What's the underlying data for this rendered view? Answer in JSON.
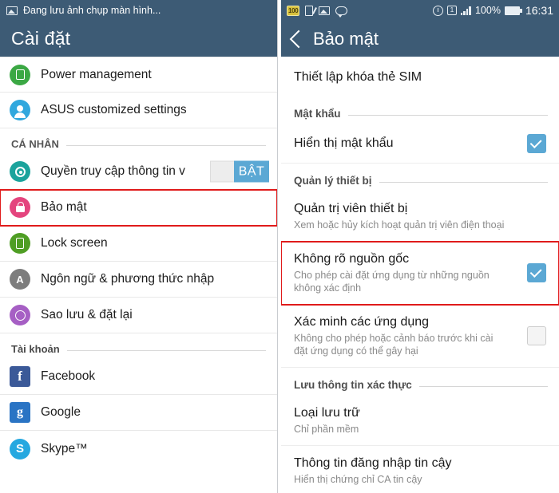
{
  "colors": {
    "header_bg": "#3d5b75",
    "accent_checkbox": "#5ba8d4",
    "highlight_outline": "#e01b1b",
    "toggle_on": "#5ba8d4"
  },
  "left_screen": {
    "statusbar": {
      "screenshot_icon": "screenshot-icon",
      "text": "Đang lưu ảnh chụp màn hình..."
    },
    "title": "Cài đặt",
    "items_top": [
      {
        "label": "Power management",
        "icon": "battery-clip-icon",
        "icon_color": "#3ba844"
      },
      {
        "label": "ASUS customized settings",
        "icon": "user-gear-icon",
        "icon_color": "#31a8de"
      }
    ],
    "section_personal": "CÁ NHÂN",
    "location_row": {
      "label": "Quyền truy cập thông tin v",
      "icon": "location-target-icon",
      "icon_color": "#1ba39c",
      "toggle_label": "BẬT"
    },
    "items_personal": [
      {
        "label": "Bảo mật",
        "icon": "lock-icon",
        "icon_color": "#e4457e",
        "highlighted": true
      },
      {
        "label": "Lock screen",
        "icon": "phone-lock-icon",
        "icon_color": "#4f9e24",
        "highlighted": false
      },
      {
        "label": "Ngôn ngữ & phương thức nhập",
        "icon": "letter-a-icon",
        "icon_color": "#7d7d7d",
        "highlighted": false
      },
      {
        "label": "Sao lưu & đặt lại",
        "icon": "backup-restore-icon",
        "icon_color": "#a65fc4",
        "highlighted": false
      }
    ],
    "section_accounts": "Tài khoản",
    "items_accounts": [
      {
        "label": "Facebook",
        "icon": "facebook-icon",
        "icon_color": "#3b5998",
        "glyph": "f"
      },
      {
        "label": "Google",
        "icon": "google-icon",
        "icon_color": "#2a74c4",
        "glyph": "g"
      },
      {
        "label": "Skype™",
        "icon": "skype-icon",
        "icon_color": "#26a8e0",
        "glyph": "S"
      }
    ]
  },
  "right_screen": {
    "statusbar": {
      "battery_badge": "100",
      "note_icon": "note-pencil-icon",
      "screenshot_icon": "screenshot-icon",
      "chat_icon": "chat-bubble-icon",
      "alarm_icon": "alarm-clock-icon",
      "sim_label": "1",
      "signal_icon": "signal-bars-icon",
      "battery_percent": "100%",
      "battery_icon": "battery-full-icon",
      "clock": "16:31"
    },
    "back_icon": "back-chevron-icon",
    "title": "Bảo mật",
    "sim_lock_item": {
      "title": "Thiết lập khóa thẻ SIM"
    },
    "section_password": "Mật khẩu",
    "show_password": {
      "title": "Hiển thị mật khẩu",
      "checked": true
    },
    "section_device_admin": "Quản lý thiết bị",
    "device_admin": {
      "title": "Quản trị viên thiết bị",
      "subtitle": "Xem hoặc hủy kích hoạt quản trị viên điện thoại"
    },
    "unknown_sources": {
      "title": "Không rõ nguồn gốc",
      "subtitle": "Cho phép cài đặt ứng dụng từ những nguồn không xác định",
      "checked": true,
      "highlighted": true
    },
    "verify_apps": {
      "title": "Xác minh các ứng dụng",
      "subtitle": "Không cho phép hoặc cảnh báo trước khi cài đặt ứng dụng có thể gây hại",
      "checked": false
    },
    "section_credentials": "Lưu thông tin xác thực",
    "storage_type": {
      "title": "Loại lưu trữ",
      "subtitle": "Chỉ phần mềm"
    },
    "trusted_credentials": {
      "title": "Thông tin đăng nhập tin cậy",
      "subtitle": "Hiển thị chứng chỉ CA tin cậy"
    }
  }
}
